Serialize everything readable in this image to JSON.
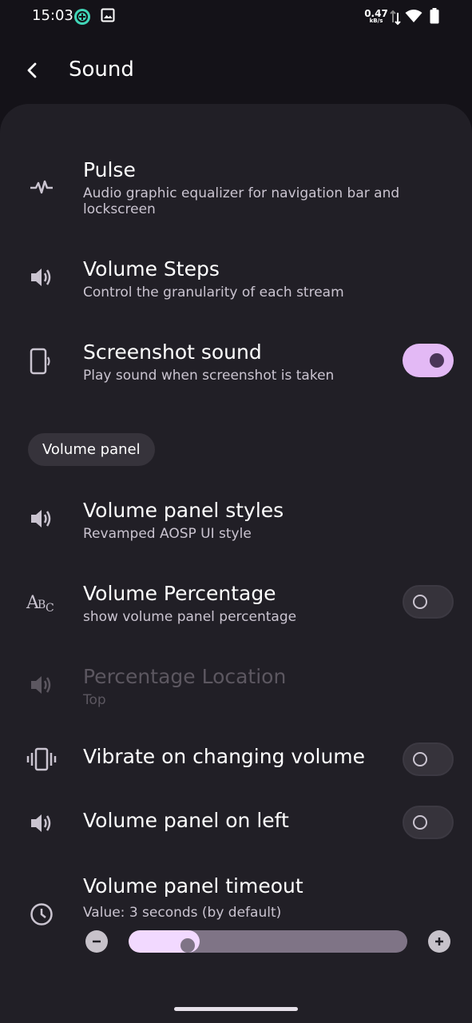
{
  "status_bar": {
    "time": "15:03",
    "net_speed_value": "0.47",
    "net_speed_unit": "kB/s"
  },
  "app_bar": {
    "title": "Sound"
  },
  "settings": {
    "pulse": {
      "title": "Pulse",
      "subtitle": "Audio graphic equalizer for navigation bar and lockscreen"
    },
    "volume_steps": {
      "title": "Volume Steps",
      "subtitle": "Control the granularity of each stream"
    },
    "screenshot_sound": {
      "title": "Screenshot sound",
      "subtitle": "Play sound when screenshot is taken",
      "enabled": true
    },
    "section_volume_panel": "Volume panel",
    "volume_panel_styles": {
      "title": "Volume panel styles",
      "subtitle": "Revamped AOSP UI style"
    },
    "volume_percentage": {
      "title": "Volume Percentage",
      "subtitle": "show volume panel percentage",
      "enabled": false
    },
    "percentage_location": {
      "title": "Percentage Location",
      "subtitle": "Top",
      "disabled": true
    },
    "vibrate_on_changing_volume": {
      "title": "Vibrate on changing volume",
      "enabled": false
    },
    "volume_panel_on_left": {
      "title": "Volume panel on left",
      "enabled": false
    },
    "volume_panel_timeout": {
      "title": "Volume panel timeout",
      "subtitle": "Value: 3 seconds (by default)",
      "slider_fraction": 0.25
    }
  },
  "icons": {
    "back": "back-arrow-icon",
    "pulse": "pulse-wave-icon",
    "speaker": "speaker-icon",
    "phone_sound": "phone-sound-icon",
    "abc": "abc-text-icon",
    "vibrate": "vibrate-icon",
    "clock": "clock-icon"
  },
  "colors": {
    "background": "#141218",
    "panel": "#211f26",
    "accent": "#e3b9f5",
    "slider_fill": "#f2d9ff"
  }
}
